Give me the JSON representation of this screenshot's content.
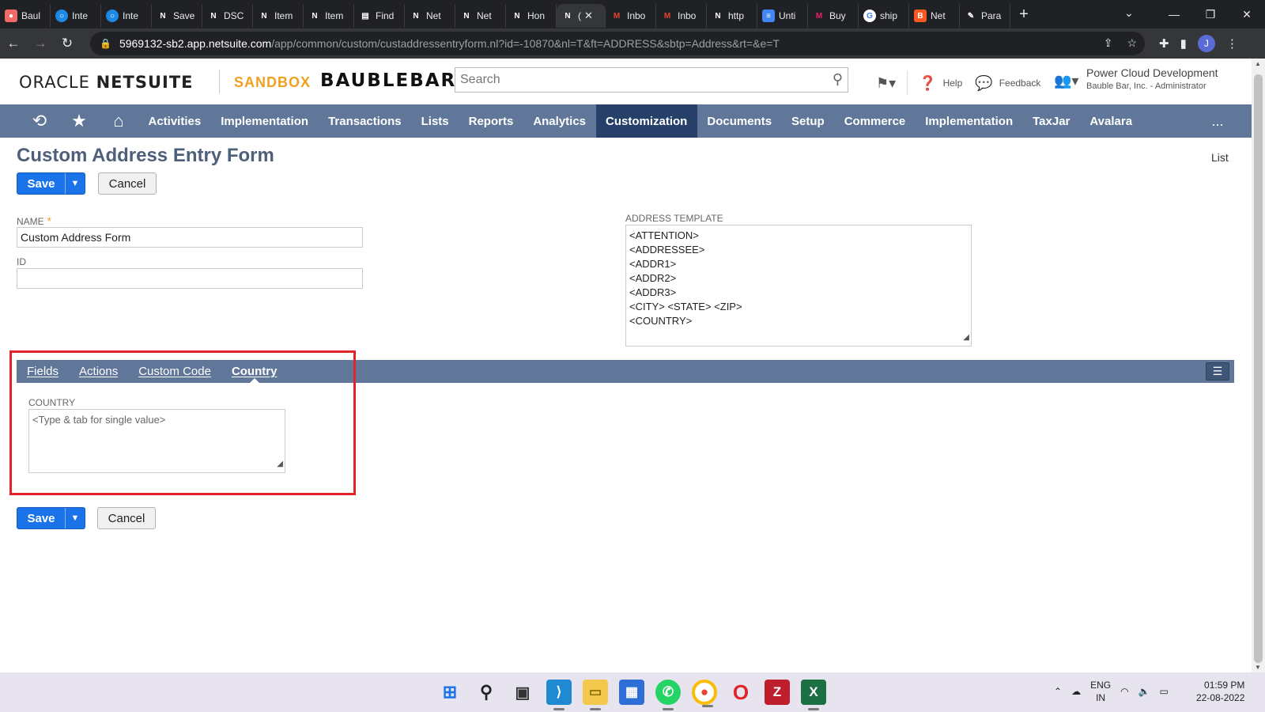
{
  "browser": {
    "tabs": [
      {
        "label": "Baul",
        "icon": "asana-icon",
        "color": "#f06a6a"
      },
      {
        "label": "Inte",
        "icon": "circle-icon",
        "color": "#1e88e5"
      },
      {
        "label": "Inte",
        "icon": "circle-icon",
        "color": "#1e88e5"
      },
      {
        "label": "Save",
        "icon": "netsuite-icon",
        "color": "#202124"
      },
      {
        "label": "DSC",
        "icon": "netsuite-icon",
        "color": "#202124"
      },
      {
        "label": "Item",
        "icon": "netsuite-icon",
        "color": "#202124"
      },
      {
        "label": "Item",
        "icon": "netsuite-icon",
        "color": "#202124"
      },
      {
        "label": "Find",
        "icon": "document-icon",
        "color": "#202124"
      },
      {
        "label": "Net",
        "icon": "netsuite-icon",
        "color": "#202124"
      },
      {
        "label": "Net",
        "icon": "netsuite-icon",
        "color": "#202124"
      },
      {
        "label": "Hon",
        "icon": "netsuite-icon",
        "color": "#202124"
      },
      {
        "label": "(",
        "icon": "netsuite-icon",
        "color": "#202124",
        "active": true
      },
      {
        "label": "Inbo",
        "icon": "gmail-icon",
        "color": "#ea4335"
      },
      {
        "label": "Inbo",
        "icon": "gmail-icon",
        "color": "#ea4335"
      },
      {
        "label": "http",
        "icon": "netsuite-icon",
        "color": "#202124"
      },
      {
        "label": "Unti",
        "icon": "docs-icon",
        "color": "#4285f4"
      },
      {
        "label": "Buy",
        "icon": "myntra-icon",
        "color": "#e91e63"
      },
      {
        "label": "ship",
        "icon": "google-icon",
        "color": "#ffffff"
      },
      {
        "label": "Net",
        "icon": "blogger-icon",
        "color": "#ff5722"
      },
      {
        "label": "Para",
        "icon": "feather-icon",
        "color": "#202124"
      }
    ],
    "url_host": "5969132-sb2.app.netsuite.com",
    "url_rest": "/app/common/custom/custaddressentryform.nl?id=-10870&nl=T&ft=ADDRESS&sbtp=Address&rt=&e=T",
    "profile_initial": "J"
  },
  "header": {
    "logo_oracle": "ORACLE",
    "logo_netsuite": "NETSUITE",
    "sandbox": "SANDBOX",
    "brand": "BAUBLEBAR",
    "search_placeholder": "Search",
    "help": "Help",
    "feedback": "Feedback",
    "account_name": "Power Cloud Development",
    "account_role": "Bauble Bar, Inc. - Administrator"
  },
  "nav": {
    "items": [
      "Activities",
      "Implementation",
      "Transactions",
      "Lists",
      "Reports",
      "Analytics",
      "Customization",
      "Documents",
      "Setup",
      "Commerce",
      "Implementation",
      "TaxJar",
      "Avalara"
    ],
    "active": "Customization",
    "more": "..."
  },
  "page": {
    "title": "Custom Address Entry Form",
    "list_link": "List",
    "save": "Save",
    "cancel": "Cancel",
    "name_label": "NAME",
    "name_value": "Custom Address Form",
    "id_label": "ID",
    "id_value": "",
    "template_label": "ADDRESS TEMPLATE",
    "template_lines": [
      "<ATTENTION>",
      "<ADDRESSEE>",
      "<ADDR1>",
      "<ADDR2>",
      "<ADDR3>",
      "<CITY> <STATE> <ZIP>",
      "<COUNTRY>"
    ],
    "subtabs": [
      "Fields",
      "Actions",
      "Custom Code",
      "Country"
    ],
    "active_subtab": "Country",
    "country_label": "COUNTRY",
    "country_placeholder": "<Type & tab for single value>"
  },
  "taskbar": {
    "lang": "ENG",
    "region": "IN",
    "time": "01:59 PM",
    "date": "22-08-2022"
  },
  "colors": {
    "nav_bg": "#607799",
    "nav_active": "#26406a",
    "save_blue": "#1a73e8",
    "highlight_red": "#e0242a",
    "sandbox_orange": "#f0a020"
  }
}
